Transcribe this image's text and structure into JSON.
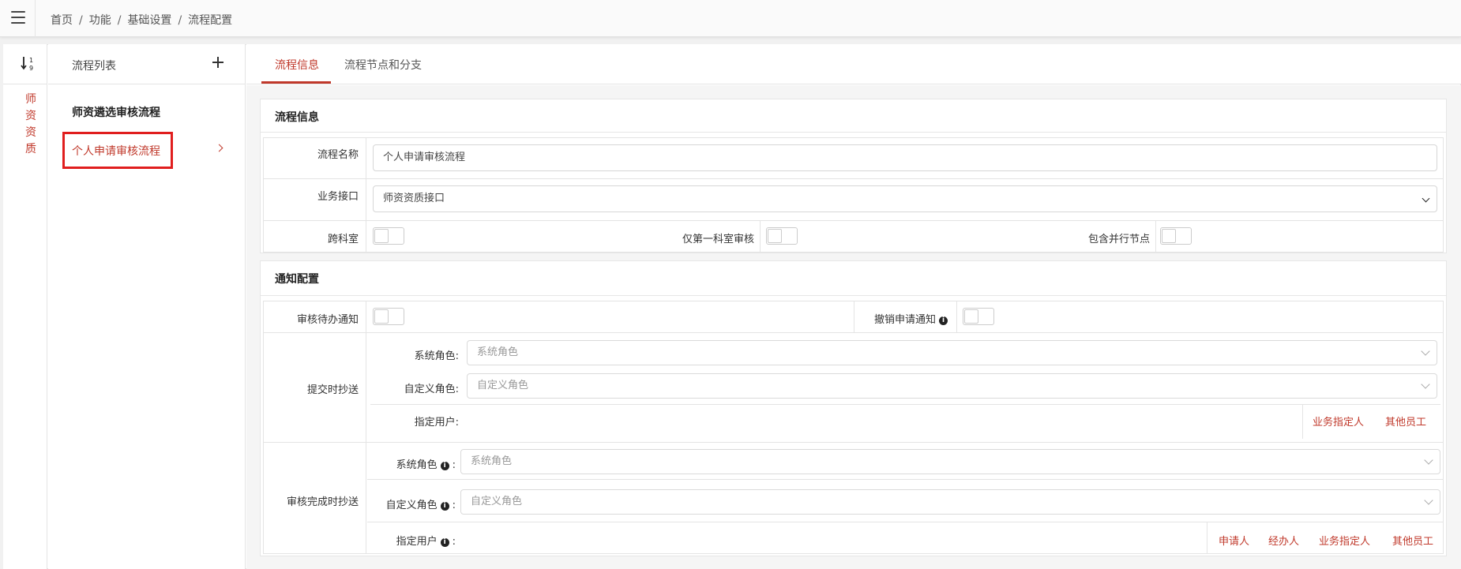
{
  "breadcrumb": [
    "首页",
    "功能",
    "基础设置",
    "流程配置"
  ],
  "left_nav": {
    "vertical_tab": [
      "师",
      "资",
      "资",
      "质"
    ]
  },
  "flow_list": {
    "header": "流程列表",
    "items": [
      {
        "label": "师资遴选审核流程"
      },
      {
        "label": "个人申请审核流程"
      }
    ]
  },
  "tabs": [
    {
      "label": "流程信息"
    },
    {
      "label": "流程节点和分支"
    }
  ],
  "flow_info": {
    "title": "流程信息",
    "name_label": "流程名称",
    "name_value": "个人申请审核流程",
    "interface_label": "业务接口",
    "interface_value": "师资资质接口",
    "cross_dept_label": "跨科室",
    "first_dept_only_label": "仅第一科室审核",
    "parallel_nodes_label": "包含并行节点"
  },
  "notify": {
    "title": "通知配置",
    "pending_label": "审核待办通知",
    "cancel_label": "撤销申请通知",
    "submit_cc": {
      "label": "提交时抄送",
      "system_role_label": "系统角色:",
      "system_role_placeholder": "系统角色",
      "custom_role_label": "自定义角色:",
      "custom_role_placeholder": "自定义角色",
      "user_label": "指定用户:",
      "links": [
        "业务指定人",
        "其他员工"
      ]
    },
    "complete_cc": {
      "label": "审核完成时抄送",
      "system_role_label": "系统角色",
      "system_role_placeholder": "系统角色",
      "custom_role_label": "自定义角色",
      "custom_role_placeholder": "自定义角色",
      "user_label": "指定用户",
      "colon": ":",
      "links": [
        "申请人",
        "经办人",
        "业务指定人",
        "其他员工"
      ]
    }
  },
  "colors": {
    "accent": "#c0392b",
    "highlight_box": "#e01e1e"
  },
  "icons": {
    "menu": "hamburger-icon",
    "sort": "sort-numeric-icon",
    "add": "plus-icon",
    "chevron": "chevron-right-icon",
    "info": "info-circle-icon",
    "dropdown": "chevron-down-icon"
  }
}
